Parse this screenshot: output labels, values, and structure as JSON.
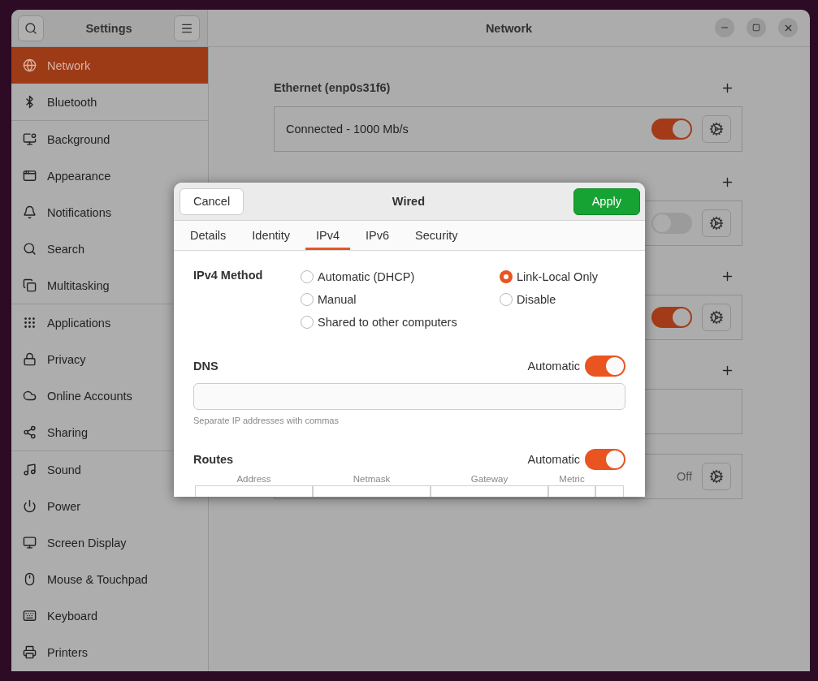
{
  "window": {
    "title": "Settings"
  },
  "sidebar": {
    "groups": [
      {
        "items": [
          {
            "label": "Network",
            "selected": true
          },
          {
            "label": "Bluetooth",
            "selected": false
          }
        ]
      },
      {
        "items": [
          {
            "label": "Background",
            "selected": false
          },
          {
            "label": "Appearance",
            "selected": false
          },
          {
            "label": "Notifications",
            "selected": false
          },
          {
            "label": "Search",
            "selected": false
          },
          {
            "label": "Multitasking",
            "selected": false
          }
        ]
      },
      {
        "items": [
          {
            "label": "Applications",
            "selected": false
          },
          {
            "label": "Privacy",
            "selected": false
          },
          {
            "label": "Online Accounts",
            "selected": false
          },
          {
            "label": "Sharing",
            "selected": false
          }
        ]
      },
      {
        "items": [
          {
            "label": "Sound",
            "selected": false
          },
          {
            "label": "Power",
            "selected": false
          },
          {
            "label": "Screen Display",
            "selected": false
          },
          {
            "label": "Mouse & Touchpad",
            "selected": false
          },
          {
            "label": "Keyboard",
            "selected": false
          },
          {
            "label": "Printers",
            "selected": false
          }
        ]
      }
    ]
  },
  "content": {
    "title": "Network",
    "sections": [
      {
        "kind": "group",
        "title": "Ethernet (enp0s31f6)",
        "card": {
          "kind": "switch",
          "status": "Connected - 1000 Mb/s",
          "on": true
        }
      },
      {
        "kind": "group",
        "card": {
          "kind": "switch",
          "on": false
        }
      },
      {
        "kind": "group",
        "card": {
          "kind": "switch",
          "on": true
        }
      },
      {
        "kind": "group",
        "card": {
          "kind": "empty"
        }
      },
      {
        "kind": "row",
        "card": {
          "kind": "state",
          "state": "Off"
        }
      }
    ]
  },
  "dialog": {
    "title": "Wired",
    "cancel": "Cancel",
    "apply": "Apply",
    "tabs": [
      {
        "label": "Details",
        "selected": false
      },
      {
        "label": "Identity",
        "selected": false
      },
      {
        "label": "IPv4",
        "selected": true
      },
      {
        "label": "IPv6",
        "selected": false
      },
      {
        "label": "Security",
        "selected": false
      }
    ],
    "ipv4_method": {
      "label": "IPv4 Method",
      "columns": [
        [
          {
            "label": "Automatic (DHCP)",
            "selected": false
          },
          {
            "label": "Manual",
            "selected": false
          },
          {
            "label": "Shared to other computers",
            "selected": false
          }
        ],
        [
          {
            "label": "Link-Local Only",
            "selected": true
          },
          {
            "label": "Disable",
            "selected": false
          }
        ]
      ]
    },
    "dns": {
      "label": "DNS",
      "auto_label": "Automatic",
      "on": true,
      "hint": "Separate IP addresses with commas"
    },
    "routes": {
      "label": "Routes",
      "auto_label": "Automatic",
      "on": true,
      "columns": [
        "Address",
        "Netmask",
        "Gateway",
        "Metric"
      ]
    }
  }
}
